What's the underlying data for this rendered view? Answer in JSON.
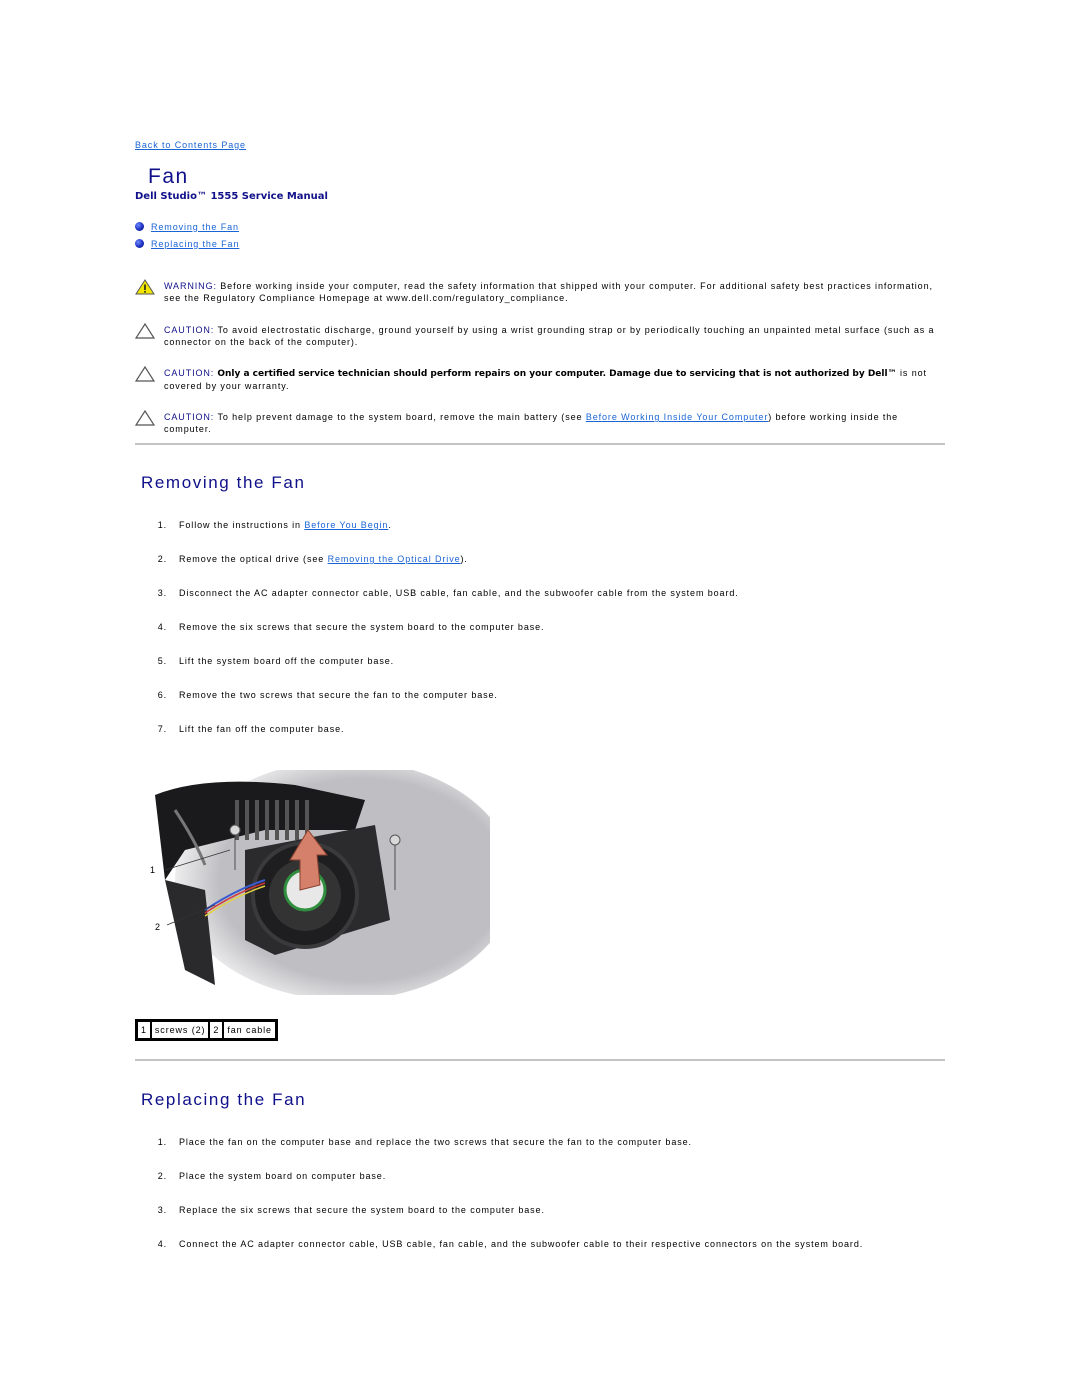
{
  "header": {
    "back_link": "Back to Contents Page",
    "page_title": "Fan",
    "manual_title": "Dell Studio™ 1555 Service Manual"
  },
  "toc": [
    {
      "label": "Removing the Fan",
      "icon": "bullet-icon"
    },
    {
      "label": "Replacing the Fan",
      "icon": "bullet-icon"
    }
  ],
  "notices": [
    {
      "icon": "warning-icon",
      "label": "WARNING:",
      "text": " Before working inside your computer, read the safety information that shipped with your computer. For additional safety best practices information, see the Regulatory Compliance Homepage at www.dell.com/regulatory_compliance."
    },
    {
      "icon": "caution-icon",
      "label": "CAUTION:",
      "text": " To avoid electrostatic discharge, ground yourself by using a wrist grounding strap or by periodically touching an unpainted metal surface (such as a connector on the back of the computer)."
    },
    {
      "icon": "caution-icon",
      "label": "CAUTION:",
      "bold_text": " Only a certified service technician should perform repairs on your computer. Damage due to servicing that is not authorized by Dell™",
      "text": " is not covered by your warranty."
    },
    {
      "icon": "caution-icon",
      "label": "CAUTION:",
      "text_before": " To help prevent damage to the system board, remove the main battery (see ",
      "link": "Before Working Inside Your Computer",
      "text_after": ") before working inside the computer."
    }
  ],
  "removing": {
    "title": "Removing the Fan",
    "steps": [
      {
        "num": "1.",
        "before": "Follow the instructions in ",
        "link": "Before You Begin",
        "after": "."
      },
      {
        "num": "2.",
        "before": "Remove the optical drive (see ",
        "link": "Removing the Optical Drive",
        "after": ")."
      },
      {
        "num": "3.",
        "text": "Disconnect the AC adapter connector cable, USB cable, fan cable, and the subwoofer cable from the system board."
      },
      {
        "num": "4.",
        "text": "Remove the six screws that secure the system board to the computer base."
      },
      {
        "num": "5.",
        "text": "Lift the system board off the computer base."
      },
      {
        "num": "6.",
        "text": "Remove the two screws that secure the fan to the computer base."
      },
      {
        "num": "7.",
        "text": "Lift the fan off the computer base."
      }
    ],
    "figure": {
      "callout_1": "1",
      "callout_2": "2"
    },
    "callouts": [
      {
        "num": "1",
        "label": "screws (2)"
      },
      {
        "num": "2",
        "label": "fan cable"
      }
    ]
  },
  "replacing": {
    "title": "Replacing the Fan",
    "steps": [
      {
        "num": "1.",
        "text": "Place the fan on the computer base and replace the two screws that secure the fan to the computer base."
      },
      {
        "num": "2.",
        "text": "Place the system board on computer base."
      },
      {
        "num": "3.",
        "text": "Replace the six screws that secure the system board to the computer base."
      },
      {
        "num": "4.",
        "text": "Connect the AC adapter connector cable, USB cable, fan cable, and the subwoofer cable to their respective connectors on the system board."
      }
    ]
  },
  "colors": {
    "heading": "#10108a",
    "link": "#1a64d6",
    "rule": "#c4c4c4",
    "warning_fill": "#f2e600"
  }
}
